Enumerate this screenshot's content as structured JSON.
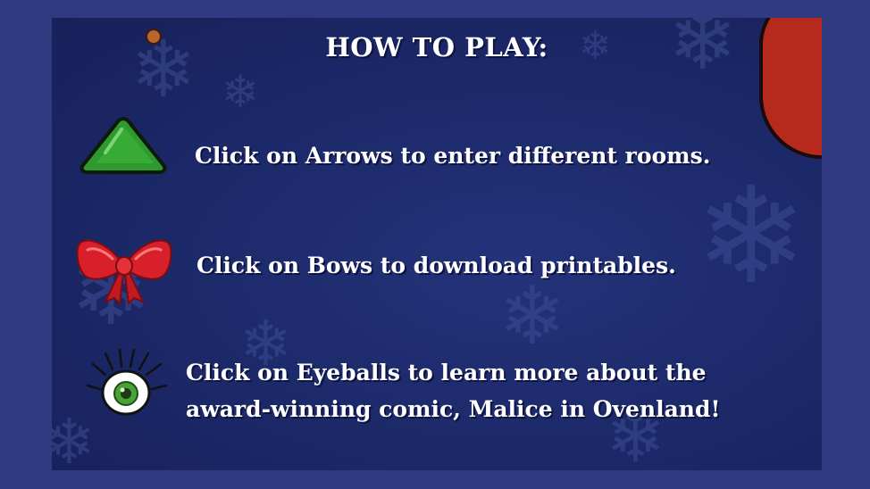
{
  "title": "HOW TO PLAY:",
  "instructions": [
    {
      "icon": "green-arrow-icon",
      "text": "Click on Arrows to enter different rooms."
    },
    {
      "icon": "red-bow-icon",
      "text": "Click on Bows to download printables."
    },
    {
      "icon": "eyeball-icon",
      "lines": [
        "Click on Eyeballs to learn more about the",
        "award-winning comic, Malice in Ovenland!"
      ]
    }
  ],
  "colors": {
    "outer_background": "#2f3a80",
    "panel_background": "#1d2a6b",
    "text": "#ffffff",
    "arrow_green": "#2e9a2e",
    "bow_red": "#d8202a",
    "eye_green": "#4aa13a"
  }
}
